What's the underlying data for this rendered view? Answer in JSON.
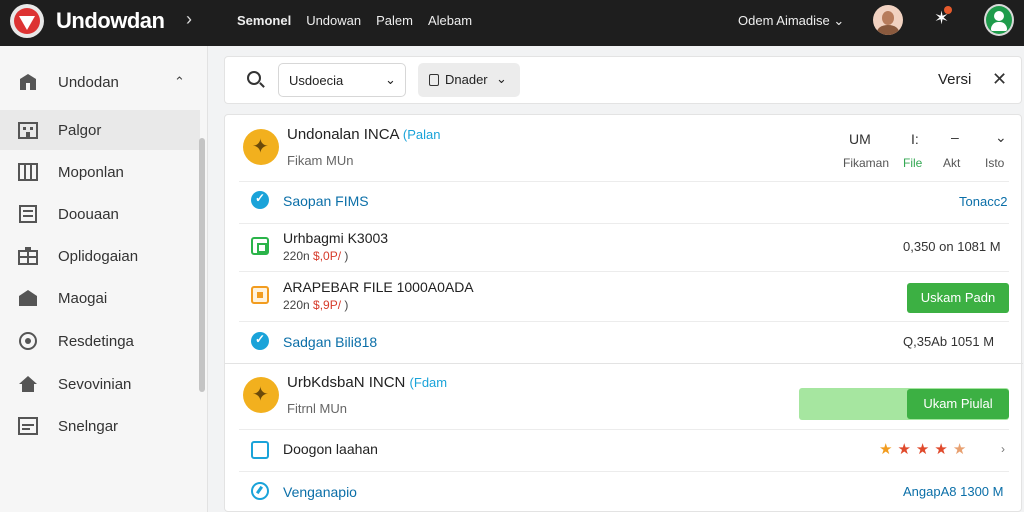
{
  "app": {
    "title": "Undowdan"
  },
  "topnav": {
    "items": [
      "Semonel",
      "Undowan",
      "Palem",
      "Alebam"
    ]
  },
  "user": {
    "name": "Odem Aimadise"
  },
  "sidebar": {
    "header": "Undodan",
    "items": [
      {
        "label": "Palgor",
        "icon": "building-icon",
        "selected": true
      },
      {
        "label": "Moponlan",
        "icon": "grid-icon"
      },
      {
        "label": "Doouaan",
        "icon": "document-icon"
      },
      {
        "label": "Oplidogaian",
        "icon": "apps-icon"
      },
      {
        "label": "Maogai",
        "icon": "home-icon"
      },
      {
        "label": "Resdetinga",
        "icon": "settings-icon"
      },
      {
        "label": "Sevovinian",
        "icon": "house-icon"
      },
      {
        "label": "Snelngar",
        "icon": "mail-icon"
      }
    ]
  },
  "toolbar": {
    "search_value": "Usdoecia",
    "filter_label": "Dnader",
    "version_label": "Versi"
  },
  "group1": {
    "title": "Undonalan INCA",
    "tag": "Palan",
    "subtitle": "Fikam MUn",
    "header_mid": "UM",
    "header_mid2": "I:",
    "header_dash": "–",
    "columns": [
      "Fikaman",
      "File",
      "Akt",
      "Isto"
    ]
  },
  "rows1": [
    {
      "label": "Saopan FIMS",
      "right": "Tonacc2"
    },
    {
      "label": "Urhbagmi K3003",
      "sub": "220n",
      "sub_red": "$,0P/",
      "sub_tail": ")",
      "right": "0,350 on 1081 M"
    },
    {
      "label": "ARAPEBAR FILE 1000A0ADA",
      "sub": "220n",
      "sub_red": "$,9P/",
      "sub_tail": ")",
      "button": "Uskam Padn"
    },
    {
      "label": "Sadgan Bili818",
      "right": "Q,35Ab 1051 M"
    }
  ],
  "group2": {
    "title": "UrbKdsbaN INCN",
    "tag": "Fdam",
    "subtitle": "Fitrnl MUn",
    "button": "Ukam Piulal",
    "progress": 0.54
  },
  "rows2": [
    {
      "label": "Doogon laahan",
      "rating": 5
    },
    {
      "label": "Venganapio",
      "right": "AngapA8 1300 M"
    }
  ],
  "colors": {
    "accent_green": "#3cb043",
    "accent_blue": "#1aa3d9",
    "topbar": "#1e1e1e"
  }
}
